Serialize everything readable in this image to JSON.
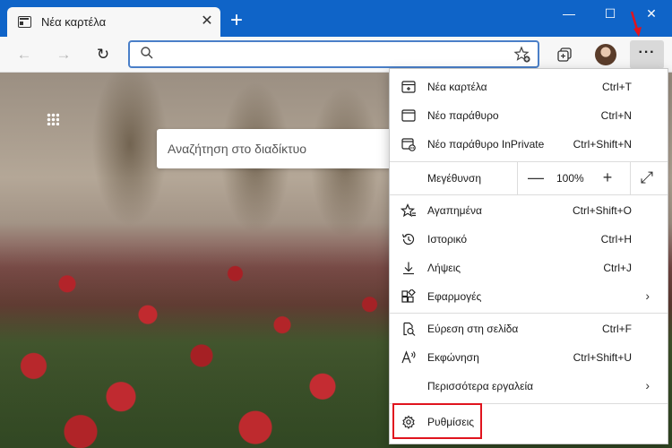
{
  "tab": {
    "title": "Νέα καρτέλα",
    "close": "✕"
  },
  "titlebar": {
    "new_tab": "+",
    "minimize": "—",
    "maximize": "☐",
    "close": "✕"
  },
  "toolbar": {
    "back": "←",
    "forward": "→",
    "refresh": "↻",
    "address_value": "",
    "more": "···"
  },
  "page": {
    "search_placeholder": "Αναζήτηση στο διαδίκτυο"
  },
  "menu": {
    "items_top": [
      {
        "label": "Νέα καρτέλα",
        "shortcut": "Ctrl+T"
      },
      {
        "label": "Νέο παράθυρο",
        "shortcut": "Ctrl+N"
      },
      {
        "label": "Νέο παράθυρο InPrivate",
        "shortcut": "Ctrl+Shift+N"
      }
    ],
    "zoom": {
      "label": "Μεγέθυνση",
      "minus": "—",
      "value": "100%",
      "plus": "+",
      "fullscreen": "⤢"
    },
    "items_mid": [
      {
        "label": "Αγαπημένα",
        "shortcut": "Ctrl+Shift+O"
      },
      {
        "label": "Ιστορικό",
        "shortcut": "Ctrl+H"
      },
      {
        "label": "Λήψεις",
        "shortcut": "Ctrl+J"
      },
      {
        "label": "Εφαρμογές",
        "shortcut": ""
      }
    ],
    "items_lower": [
      {
        "label": "Εύρεση στη σελίδα",
        "shortcut": "Ctrl+F"
      },
      {
        "label": "Εκφώνηση",
        "shortcut": "Ctrl+Shift+U"
      },
      {
        "label": "Περισσότερα εργαλεία",
        "shortcut": ""
      }
    ],
    "settings": {
      "label": "Ρυθμίσεις"
    }
  },
  "colors": {
    "accent": "#0f64c8",
    "highlight": "#e0141e"
  }
}
